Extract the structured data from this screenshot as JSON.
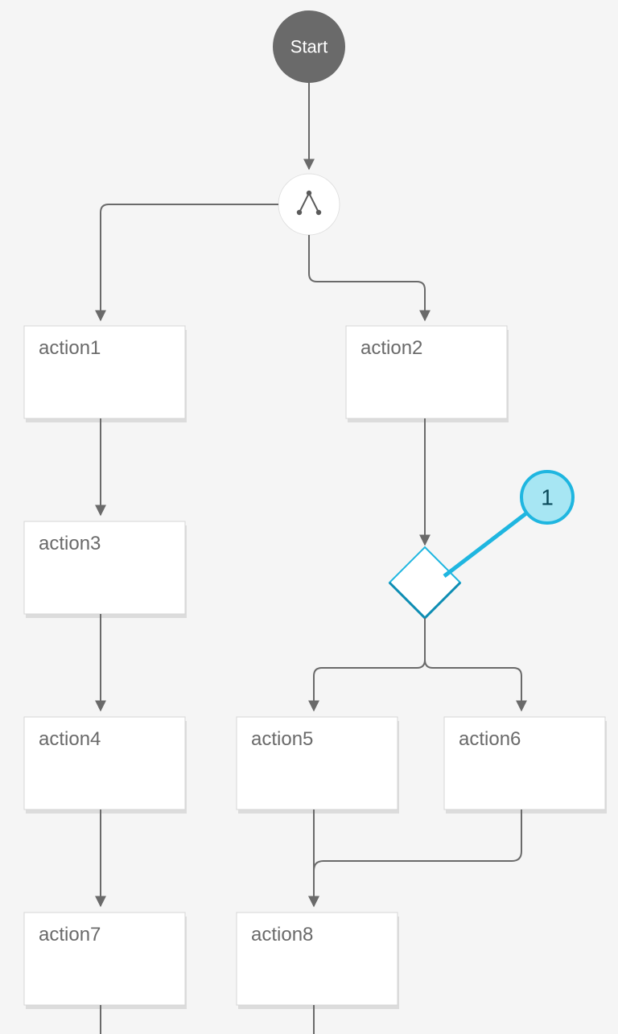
{
  "colors": {
    "accent": "#1fb6e0",
    "accent_fill": "#a7e6f3",
    "callout_text": "#0a4a5a"
  },
  "start": {
    "label": "Start"
  },
  "nodes": {
    "a1": "action1",
    "a2": "action2",
    "a3": "action3",
    "a4": "action4",
    "a5": "action5",
    "a6": "action6",
    "a7": "action7",
    "a8": "action8"
  },
  "callout": {
    "label": "1"
  }
}
